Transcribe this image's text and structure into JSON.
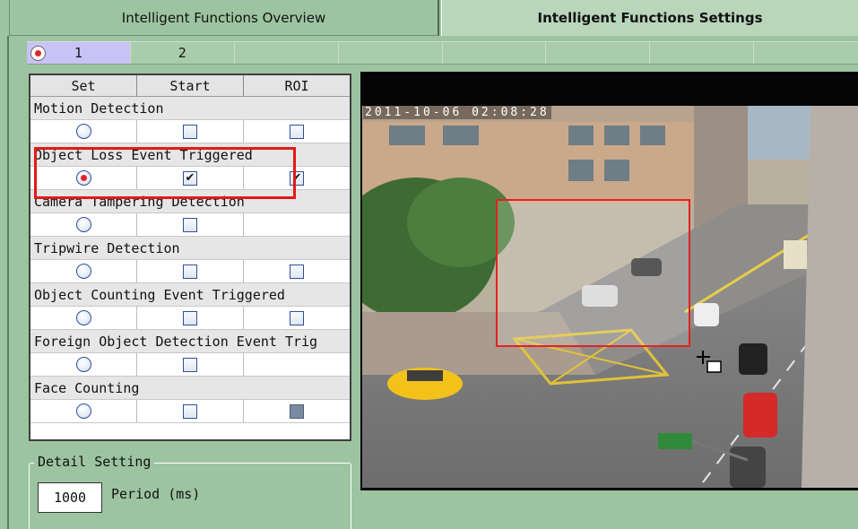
{
  "tabs": [
    {
      "label": "Intelligent Functions Overview",
      "active": false
    },
    {
      "label": "Intelligent Functions Settings",
      "active": true
    }
  ],
  "channels": [
    {
      "label": "1",
      "selected": true
    },
    {
      "label": "2",
      "selected": false
    }
  ],
  "table": {
    "headers": [
      "Set",
      "Start",
      "ROI"
    ],
    "functions": [
      {
        "name": "Motion Detection",
        "set": false,
        "start": false,
        "roi": false,
        "has_roi": true
      },
      {
        "name": "Object Loss Event Triggered",
        "set": true,
        "start": true,
        "roi": true,
        "has_roi": true
      },
      {
        "name": "Camera Tampering Detection",
        "set": false,
        "start": false,
        "roi": null,
        "has_roi": false
      },
      {
        "name": "Tripwire Detection",
        "set": false,
        "start": false,
        "roi": false,
        "has_roi": true
      },
      {
        "name": "Object Counting Event Triggered",
        "set": false,
        "start": false,
        "roi": false,
        "has_roi": true
      },
      {
        "name": "Foreign Object Detection Event Trig",
        "set": false,
        "start": false,
        "roi": null,
        "has_roi": false
      },
      {
        "name": "Face Counting",
        "set": false,
        "start": false,
        "roi": "disabled",
        "has_roi": true
      }
    ]
  },
  "detail": {
    "legend": "Detail Setting",
    "period_value": "1000",
    "period_label": "Period (ms)"
  },
  "video": {
    "timestamp": "2011-10-06  02:08:28"
  },
  "colors": {
    "panel_bg": "#9cc4a0",
    "active_channel": "#c9c2f4",
    "highlight": "#e21a1a",
    "roi": "#e52020"
  }
}
